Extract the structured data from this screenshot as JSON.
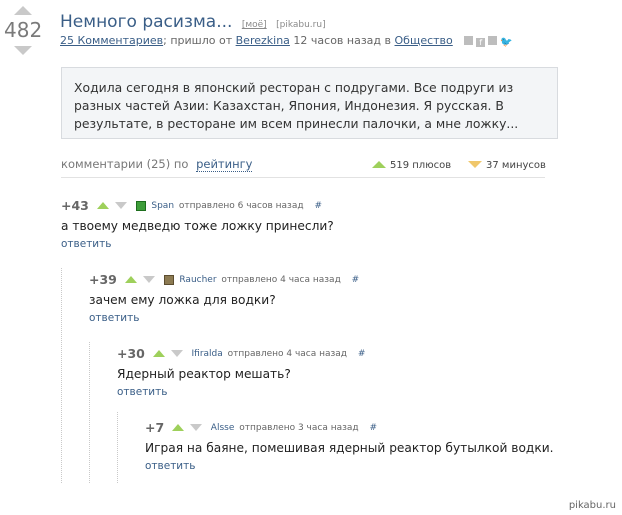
{
  "post": {
    "rating": "482",
    "title": "Немного расизма...",
    "mine_label": "[моё]",
    "source": "[pikabu.ru]",
    "comments_link": "25 Комментариев",
    "meta_mid": "; пришло от",
    "author": "Berezkina",
    "meta_time": "12 часов назад в",
    "community": "Общество",
    "story": "Ходила сегодня в японский ресторан с подругами. Все подруги из разных частей Азии: Казахстан, Япония, Индонезия. Я русская. В результате, в ресторане им всем принесли палочки, а мне ложку..."
  },
  "comments_bar": {
    "label": "комментарии (25) по",
    "sort": "рейтингу",
    "plus": "519 плюсов",
    "minus": "37 минусов"
  },
  "comments": [
    {
      "score": "+43",
      "author": "Span",
      "time": "отправлено 6 часов назад",
      "hash": "#",
      "text": "а твоему медведю тоже ложку принесли?",
      "reply": "ответить"
    },
    {
      "score": "+39",
      "author": "Raucher",
      "time": "отправлено 4 часа назад",
      "hash": "#",
      "text": "зачем ему ложка для водки?",
      "reply": "ответить"
    },
    {
      "score": "+30",
      "author": "Ifiralda",
      "time": "отправлено 4 часа назад",
      "hash": "#",
      "text": "Ядерный реактор мешать?",
      "reply": "ответить"
    },
    {
      "score": "+7",
      "author": "Alsse",
      "time": "отправлено 3 часа назад",
      "hash": "#",
      "text": "Играя на баяне, помешивая ядерный реактор бутылкой водки.",
      "reply": "ответить"
    }
  ],
  "watermark": "pikabu.ru",
  "colors": {
    "link": "#3a5e87",
    "vote_up": "#9ed05b",
    "minus": "#f0c76b",
    "story_bg": "#f3f5f7"
  }
}
